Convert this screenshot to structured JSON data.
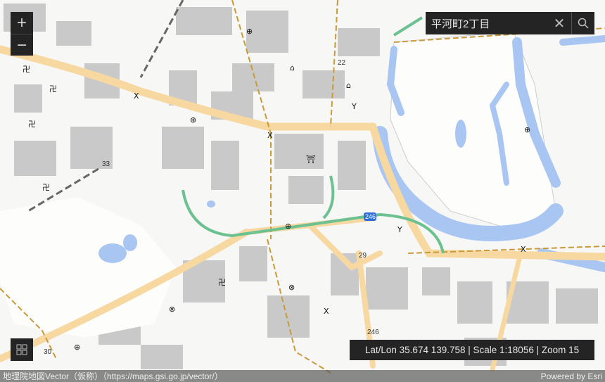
{
  "search": {
    "value": "平河町2丁目",
    "clear_icon": "close-icon",
    "search_icon": "search-icon"
  },
  "zoom": {
    "in_label": "+",
    "out_label": "−"
  },
  "readout": {
    "text": "Lat/Lon 35.674 139.758 | Scale 1:18056 | Zoom 15"
  },
  "attribution": {
    "source": "地理院地図Vector（仮称）（https://maps.gsi.go.jp/vector/）",
    "powered": "Powered by Esri"
  },
  "map_labels": {
    "r22": "22",
    "r33": "33",
    "r29": "29",
    "r246": "246",
    "r30": "30",
    "r246b": "246"
  },
  "colors": {
    "water": "#a9c6f3",
    "road": "#f7d8a0",
    "block": "#c8c8c8",
    "green": "#7fcf9f"
  }
}
